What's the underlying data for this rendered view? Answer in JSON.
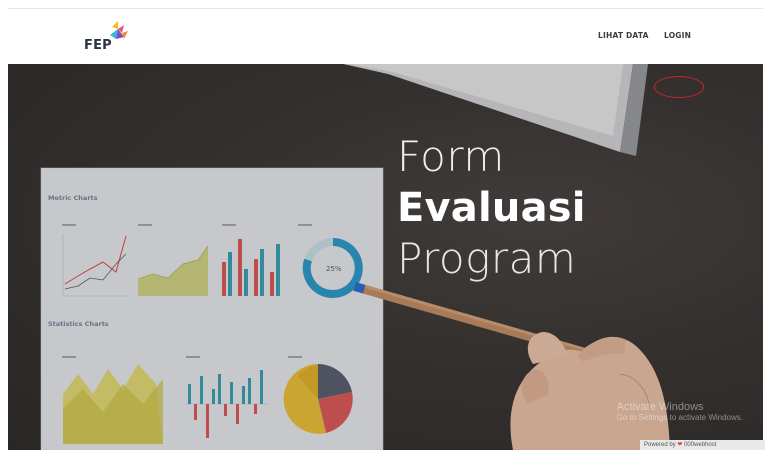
{
  "brand": {
    "name": "FEP"
  },
  "nav": {
    "items": [
      {
        "label": "LIHAT DATA"
      },
      {
        "label": "LOGIN"
      }
    ]
  },
  "hero": {
    "title_line1": "Form",
    "title_line2": "Evaluasi",
    "title_line3": "Program"
  },
  "illustration": {
    "chart_sheet_title1": "Metric Charts",
    "chart_sheet_title2": "Statistics Charts",
    "pie_percent": "25%"
  },
  "overlay": {
    "watermark_line1": "Activate Windows",
    "watermark_line2": "Go to Settings to activate Windows.",
    "badge_left": "Powered by",
    "badge_right": "000webhost"
  },
  "colors": {
    "annotation": "#c62828",
    "brand_text": "#2a3447"
  }
}
